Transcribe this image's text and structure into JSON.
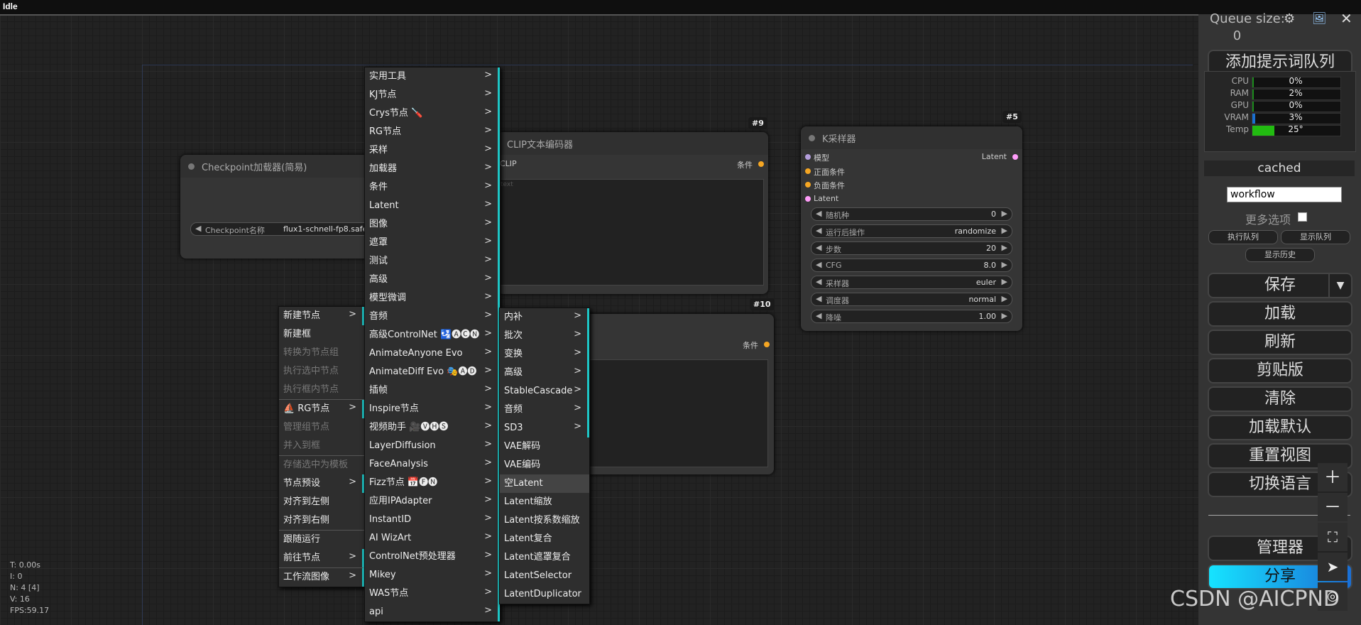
{
  "title": "Idle",
  "nodes": {
    "checkpoint": {
      "title": "Checkpoint加载器(简易)",
      "widget_label": "Checkpoint名称",
      "widget_value": "flux1-schnell-fp8.safe"
    },
    "clip9": {
      "badge": "#9",
      "title": "CLIP文本编码器",
      "input": "CLIP",
      "output": "条件",
      "placeholder": "text"
    },
    "clip10": {
      "badge": "#10",
      "output": "条件"
    },
    "ksampler": {
      "badge": "#5",
      "title": "K采样器",
      "inputs": [
        "模型",
        "正面条件",
        "负面条件",
        "Latent"
      ],
      "output": "Latent",
      "widgets": [
        {
          "label": "随机种",
          "value": "0"
        },
        {
          "label": "运行后操作",
          "value": "randomize"
        },
        {
          "label": "步数",
          "value": "20"
        },
        {
          "label": "CFG",
          "value": "8.0"
        },
        {
          "label": "采样器",
          "value": "euler"
        },
        {
          "label": "调度器",
          "value": "normal"
        },
        {
          "label": "降噪",
          "value": "1.00"
        }
      ]
    }
  },
  "menu1": [
    {
      "label": "新建节点",
      "arrow": true
    },
    {
      "label": "新建框"
    },
    {
      "label": "转换为节点组",
      "disabled": true
    },
    {
      "label": "执行选中节点",
      "disabled": true
    },
    {
      "label": "执行框内节点",
      "disabled": true
    },
    {
      "label": "RG节点",
      "arrow": true,
      "icon": "⛵"
    },
    {
      "label": "管理组节点",
      "disabled": true
    },
    {
      "label": "并入到框",
      "disabled": true
    },
    {
      "label": "存储选中为模板",
      "disabled": true
    },
    {
      "label": "节点预设",
      "arrow": true
    },
    {
      "label": "对齐到左侧"
    },
    {
      "label": "对齐到右侧"
    },
    {
      "label": "跟随运行"
    },
    {
      "label": "前往节点",
      "arrow": true
    },
    {
      "label": "工作流图像",
      "arrow": true
    }
  ],
  "menu2": [
    "实用工具",
    "KJ节点",
    "Crys节点 🪛",
    "RG节点",
    "采样",
    "加载器",
    "条件",
    "Latent",
    "图像",
    "遮罩",
    "测试",
    "高级",
    "模型微调",
    "音频",
    "高级ControlNet 🛂🅐🅒🅝",
    "AnimateAnyone Evo",
    "AnimateDiff Evo 🎭🅐🅓",
    "插帧",
    "Inspire节点",
    "视频助手 🎥🅥🅗🅢",
    "LayerDiffusion",
    "FaceAnalysis",
    "Fizz节点 📅🅕🅝",
    "应用IPAdapter",
    "InstantID",
    "AI WizArt",
    "ControlNet预处理器",
    "Mikey",
    "WAS节点",
    "api"
  ],
  "menu3": [
    {
      "label": "内补",
      "arrow": true
    },
    {
      "label": "批次",
      "arrow": true
    },
    {
      "label": "变换",
      "arrow": true
    },
    {
      "label": "高级",
      "arrow": true
    },
    {
      "label": "StableCascade",
      "arrow": true
    },
    {
      "label": "音频",
      "arrow": true
    },
    {
      "label": "SD3",
      "arrow": true
    },
    {
      "label": "VAE解码"
    },
    {
      "label": "VAE编码"
    },
    {
      "label": "空Latent",
      "selected": true
    },
    {
      "label": "Latent缩放"
    },
    {
      "label": "Latent按系数缩放"
    },
    {
      "label": "Latent复合"
    },
    {
      "label": "Latent遮罩复合"
    },
    {
      "label": "LatentSelector"
    },
    {
      "label": "LatentDuplicator"
    }
  ],
  "sidebar": {
    "queue_label": "Queue size:",
    "queue_value": "0",
    "add_queue": "添加提示词队列",
    "stats": [
      {
        "name": "CPU",
        "value": "0%",
        "fraction": 0.0,
        "color": "#1a8a1a"
      },
      {
        "name": "RAM",
        "value": "2%",
        "fraction": 0.02,
        "color": "#1a8a1a"
      },
      {
        "name": "GPU",
        "value": "0%",
        "fraction": 0.0,
        "color": "#1a8a1a"
      },
      {
        "name": "VRAM",
        "value": "3%",
        "fraction": 0.03,
        "color": "#1b6fd0"
      },
      {
        "name": "Temp",
        "value": "25°",
        "fraction": 0.25,
        "color": "#22bb11"
      }
    ],
    "cached": "cached",
    "workflow_value": "workflow",
    "more_options": "更多选项",
    "run_queue": "执行队列",
    "show_queue": "显示队列",
    "show_history": "显示历史",
    "save": "保存",
    "load": "加载",
    "refresh": "刷新",
    "clipboard": "剪贴版",
    "clear": "清除",
    "load_default": "加载默认",
    "reset_view": "重置视图",
    "switch_lang": "切换语言",
    "manager": "管理器",
    "share": "分享"
  },
  "info": {
    "t": "T: 0.00s",
    "i": "I: 0",
    "n": "N: 4 [4]",
    "v": "V: 16",
    "fps": "FPS:59.17"
  },
  "watermark": "CSDN @AICPND"
}
